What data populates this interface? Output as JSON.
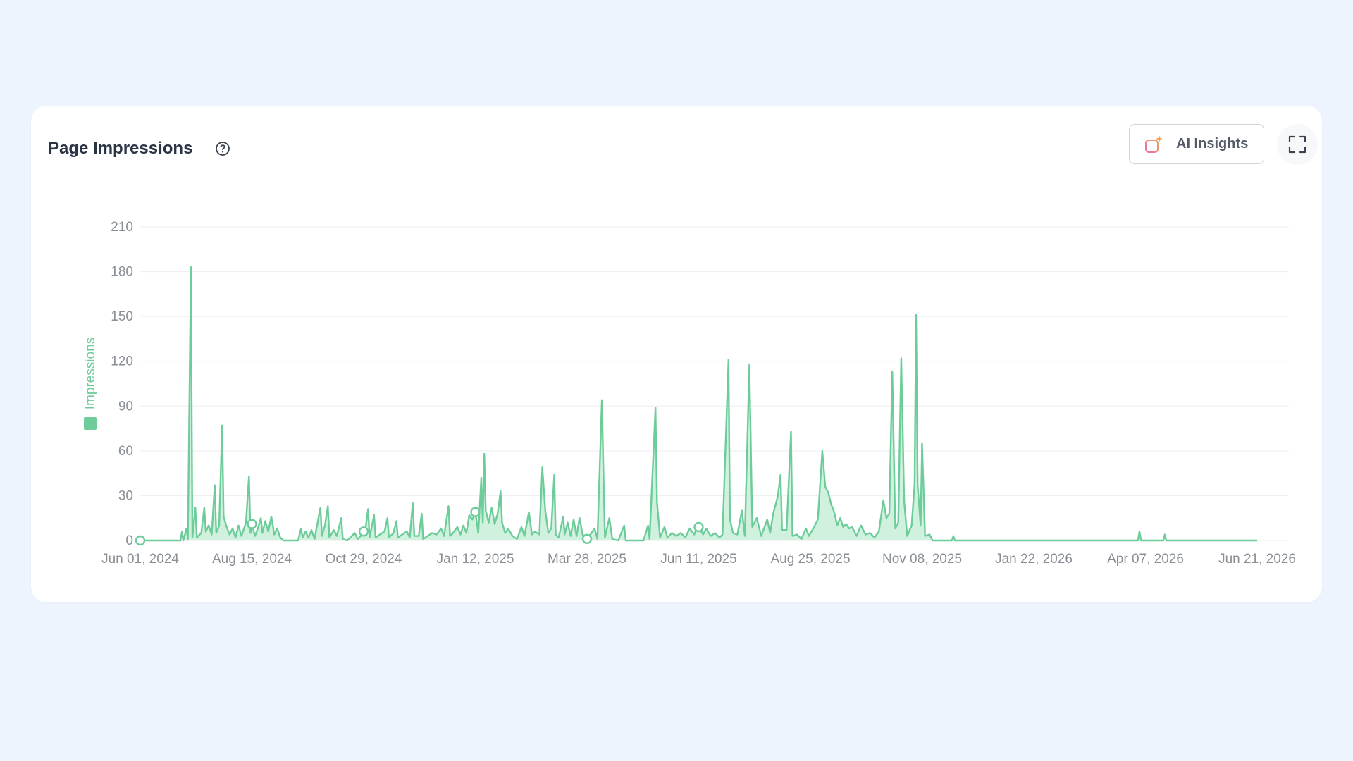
{
  "header": {
    "title": "Page Impressions",
    "help_icon": "question-circle-icon",
    "ai_button_label": "AI Insights",
    "ai_icon": "ai-chart-sparkle-icon",
    "expand_icon": "fullscreen-icon"
  },
  "colors": {
    "series": "#6dcc99",
    "area": "#c7eed8",
    "grid": "#eceef2",
    "ai_icon_gradient": [
      "#ef6aa4",
      "#f0a35a"
    ]
  },
  "chart_data": {
    "type": "area",
    "title": "",
    "xlabel": "",
    "ylabel": "",
    "ylim": [
      0,
      210
    ],
    "yticks": [
      "0",
      "30",
      "60",
      "90",
      "120",
      "150",
      "180",
      "210"
    ],
    "xticks": [
      "Jun 01, 2024",
      "Aug 15, 2024",
      "Oct 29, 2024",
      "Jan 12, 2025",
      "Mar 28, 2025",
      "Jun 11, 2025",
      "Aug 25, 2025",
      "Nov 08, 2025",
      "Jan 22, 2026",
      "Apr 07, 2026",
      "Jun 21, 2026"
    ],
    "x_range": [
      "2024-06-01",
      "2026-06-21"
    ],
    "grid": true,
    "legend": {
      "position": "left-vertical",
      "entries": [
        "Impressions"
      ]
    },
    "series": [
      {
        "name": "Impressions",
        "points": [
          [
            "2024-06-01",
            0
          ],
          [
            "2024-06-28",
            0
          ],
          [
            "2024-06-29",
            6
          ],
          [
            "2024-06-30",
            0
          ],
          [
            "2024-07-02",
            8
          ],
          [
            "2024-07-03",
            1
          ],
          [
            "2024-07-05",
            183
          ],
          [
            "2024-07-06",
            2
          ],
          [
            "2024-07-08",
            22
          ],
          [
            "2024-07-09",
            2
          ],
          [
            "2024-07-12",
            5
          ],
          [
            "2024-07-14",
            22
          ],
          [
            "2024-07-15",
            6
          ],
          [
            "2024-07-17",
            10
          ],
          [
            "2024-07-19",
            4
          ],
          [
            "2024-07-21",
            37
          ],
          [
            "2024-07-22",
            5
          ],
          [
            "2024-07-24",
            10
          ],
          [
            "2024-07-26",
            77
          ],
          [
            "2024-07-27",
            16
          ],
          [
            "2024-07-29",
            9
          ],
          [
            "2024-07-31",
            4
          ],
          [
            "2024-08-02",
            8
          ],
          [
            "2024-08-04",
            2
          ],
          [
            "2024-08-06",
            10
          ],
          [
            "2024-08-08",
            3
          ],
          [
            "2024-08-11",
            12
          ],
          [
            "2024-08-13",
            43
          ],
          [
            "2024-08-14",
            5
          ],
          [
            "2024-08-15",
            11
          ],
          [
            "2024-08-17",
            3
          ],
          [
            "2024-08-19",
            8
          ],
          [
            "2024-08-21",
            15
          ],
          [
            "2024-08-22",
            5
          ],
          [
            "2024-08-24",
            13
          ],
          [
            "2024-08-26",
            6
          ],
          [
            "2024-08-28",
            16
          ],
          [
            "2024-08-30",
            4
          ],
          [
            "2024-09-01",
            8
          ],
          [
            "2024-09-03",
            2
          ],
          [
            "2024-09-05",
            0
          ],
          [
            "2024-09-15",
            0
          ],
          [
            "2024-09-17",
            8
          ],
          [
            "2024-09-18",
            2
          ],
          [
            "2024-09-20",
            6
          ],
          [
            "2024-09-22",
            2
          ],
          [
            "2024-09-24",
            7
          ],
          [
            "2024-09-26",
            1
          ],
          [
            "2024-09-30",
            22
          ],
          [
            "2024-10-01",
            3
          ],
          [
            "2024-10-03",
            10
          ],
          [
            "2024-10-05",
            23
          ],
          [
            "2024-10-06",
            2
          ],
          [
            "2024-10-09",
            7
          ],
          [
            "2024-10-11",
            3
          ],
          [
            "2024-10-14",
            15
          ],
          [
            "2024-10-15",
            1
          ],
          [
            "2024-10-18",
            0
          ],
          [
            "2024-10-20",
            2
          ],
          [
            "2024-10-23",
            5
          ],
          [
            "2024-10-25",
            1
          ],
          [
            "2024-10-30",
            6
          ],
          [
            "2024-11-01",
            21
          ],
          [
            "2024-11-02",
            2
          ],
          [
            "2024-11-05",
            17
          ],
          [
            "2024-11-06",
            2
          ],
          [
            "2024-11-09",
            4
          ],
          [
            "2024-11-12",
            6
          ],
          [
            "2024-11-14",
            15
          ],
          [
            "2024-11-15",
            2
          ],
          [
            "2024-11-18",
            5
          ],
          [
            "2024-11-20",
            13
          ],
          [
            "2024-11-21",
            2
          ],
          [
            "2024-11-24",
            4
          ],
          [
            "2024-11-27",
            6
          ],
          [
            "2024-11-29",
            2
          ],
          [
            "2024-12-01",
            25
          ],
          [
            "2024-12-02",
            3
          ],
          [
            "2024-12-05",
            3
          ],
          [
            "2024-12-07",
            18
          ],
          [
            "2024-12-08",
            1
          ],
          [
            "2024-12-11",
            3
          ],
          [
            "2024-12-14",
            5
          ],
          [
            "2024-12-17",
            4
          ],
          [
            "2024-12-20",
            8
          ],
          [
            "2024-12-22",
            3
          ],
          [
            "2024-12-25",
            23
          ],
          [
            "2024-12-26",
            3
          ],
          [
            "2024-12-28",
            5
          ],
          [
            "2024-12-31",
            9
          ],
          [
            "2025-01-02",
            4
          ],
          [
            "2025-01-04",
            10
          ],
          [
            "2025-01-06",
            5
          ],
          [
            "2025-01-08",
            17
          ],
          [
            "2025-01-10",
            14
          ],
          [
            "2025-01-12",
            19
          ],
          [
            "2025-01-14",
            5
          ],
          [
            "2025-01-16",
            42
          ],
          [
            "2025-01-17",
            12
          ],
          [
            "2025-01-18",
            58
          ],
          [
            "2025-01-19",
            20
          ],
          [
            "2025-01-21",
            12
          ],
          [
            "2025-01-23",
            22
          ],
          [
            "2025-01-25",
            11
          ],
          [
            "2025-01-27",
            18
          ],
          [
            "2025-01-29",
            33
          ],
          [
            "2025-01-30",
            12
          ],
          [
            "2025-02-01",
            5
          ],
          [
            "2025-02-03",
            8
          ],
          [
            "2025-02-06",
            3
          ],
          [
            "2025-02-09",
            1
          ],
          [
            "2025-02-12",
            9
          ],
          [
            "2025-02-14",
            3
          ],
          [
            "2025-02-17",
            19
          ],
          [
            "2025-02-19",
            4
          ],
          [
            "2025-02-21",
            6
          ],
          [
            "2025-02-24",
            4
          ],
          [
            "2025-02-26",
            49
          ],
          [
            "2025-02-28",
            20
          ],
          [
            "2025-03-02",
            5
          ],
          [
            "2025-03-04",
            8
          ],
          [
            "2025-03-06",
            44
          ],
          [
            "2025-03-07",
            4
          ],
          [
            "2025-03-09",
            2
          ],
          [
            "2025-03-12",
            16
          ],
          [
            "2025-03-13",
            4
          ],
          [
            "2025-03-15",
            12
          ],
          [
            "2025-03-17",
            3
          ],
          [
            "2025-03-19",
            14
          ],
          [
            "2025-03-21",
            3
          ],
          [
            "2025-03-23",
            15
          ],
          [
            "2025-03-25",
            4
          ],
          [
            "2025-03-28",
            1
          ],
          [
            "2025-03-31",
            5
          ],
          [
            "2025-04-02",
            8
          ],
          [
            "2025-04-04",
            1
          ],
          [
            "2025-04-07",
            94
          ],
          [
            "2025-04-09",
            2
          ],
          [
            "2025-04-12",
            15
          ],
          [
            "2025-04-14",
            1
          ],
          [
            "2025-04-18",
            0
          ],
          [
            "2025-04-22",
            10
          ],
          [
            "2025-04-23",
            0
          ],
          [
            "2025-05-05",
            0
          ],
          [
            "2025-05-08",
            10
          ],
          [
            "2025-05-09",
            1
          ],
          [
            "2025-05-13",
            89
          ],
          [
            "2025-05-14",
            26
          ],
          [
            "2025-05-16",
            2
          ],
          [
            "2025-05-19",
            9
          ],
          [
            "2025-05-21",
            2
          ],
          [
            "2025-05-24",
            5
          ],
          [
            "2025-05-27",
            3
          ],
          [
            "2025-05-30",
            5
          ],
          [
            "2025-06-02",
            2
          ],
          [
            "2025-06-05",
            8
          ],
          [
            "2025-06-08",
            4
          ],
          [
            "2025-06-10",
            9
          ],
          [
            "2025-06-12",
            7
          ],
          [
            "2025-06-14",
            4
          ],
          [
            "2025-06-16",
            8
          ],
          [
            "2025-06-19",
            3
          ],
          [
            "2025-06-22",
            5
          ],
          [
            "2025-06-25",
            2
          ],
          [
            "2025-06-27",
            4
          ],
          [
            "2025-07-01",
            121
          ],
          [
            "2025-07-02",
            14
          ],
          [
            "2025-07-04",
            5
          ],
          [
            "2025-07-07",
            4
          ],
          [
            "2025-07-10",
            20
          ],
          [
            "2025-07-12",
            3
          ],
          [
            "2025-07-15",
            118
          ],
          [
            "2025-07-17",
            9
          ],
          [
            "2025-07-20",
            15
          ],
          [
            "2025-07-23",
            3
          ],
          [
            "2025-07-27",
            14
          ],
          [
            "2025-07-29",
            5
          ],
          [
            "2025-07-31",
            18
          ],
          [
            "2025-08-03",
            29
          ],
          [
            "2025-08-05",
            44
          ],
          [
            "2025-08-06",
            7
          ],
          [
            "2025-08-09",
            7
          ],
          [
            "2025-08-12",
            73
          ],
          [
            "2025-08-13",
            3
          ],
          [
            "2025-08-16",
            4
          ],
          [
            "2025-08-19",
            1
          ],
          [
            "2025-08-22",
            8
          ],
          [
            "2025-08-24",
            3
          ],
          [
            "2025-08-27",
            8
          ],
          [
            "2025-08-30",
            14
          ],
          [
            "2025-09-02",
            60
          ],
          [
            "2025-09-04",
            36
          ],
          [
            "2025-09-06",
            32
          ],
          [
            "2025-09-08",
            24
          ],
          [
            "2025-09-10",
            19
          ],
          [
            "2025-09-12",
            10
          ],
          [
            "2025-09-14",
            15
          ],
          [
            "2025-09-16",
            9
          ],
          [
            "2025-09-18",
            11
          ],
          [
            "2025-09-20",
            8
          ],
          [
            "2025-09-22",
            9
          ],
          [
            "2025-09-25",
            3
          ],
          [
            "2025-09-28",
            10
          ],
          [
            "2025-10-01",
            4
          ],
          [
            "2025-10-04",
            5
          ],
          [
            "2025-10-07",
            2
          ],
          [
            "2025-10-10",
            6
          ],
          [
            "2025-10-13",
            27
          ],
          [
            "2025-10-15",
            15
          ],
          [
            "2025-10-17",
            18
          ],
          [
            "2025-10-19",
            113
          ],
          [
            "2025-10-21",
            8
          ],
          [
            "2025-10-23",
            12
          ],
          [
            "2025-10-25",
            122
          ],
          [
            "2025-10-27",
            26
          ],
          [
            "2025-10-29",
            3
          ],
          [
            "2025-11-01",
            10
          ],
          [
            "2025-11-03",
            38
          ],
          [
            "2025-11-04",
            151
          ],
          [
            "2025-11-05",
            37
          ],
          [
            "2025-11-07",
            10
          ],
          [
            "2025-11-08",
            65
          ],
          [
            "2025-11-10",
            3
          ],
          [
            "2025-11-13",
            4
          ],
          [
            "2025-11-15",
            0
          ],
          [
            "2025-11-28",
            0
          ],
          [
            "2025-11-29",
            3
          ],
          [
            "2025-11-30",
            0
          ],
          [
            "2026-04-02",
            0
          ],
          [
            "2026-04-03",
            6
          ],
          [
            "2026-04-04",
            0
          ],
          [
            "2026-04-19",
            0
          ],
          [
            "2026-04-20",
            4
          ],
          [
            "2026-04-21",
            0
          ],
          [
            "2026-06-21",
            0
          ]
        ]
      }
    ]
  }
}
